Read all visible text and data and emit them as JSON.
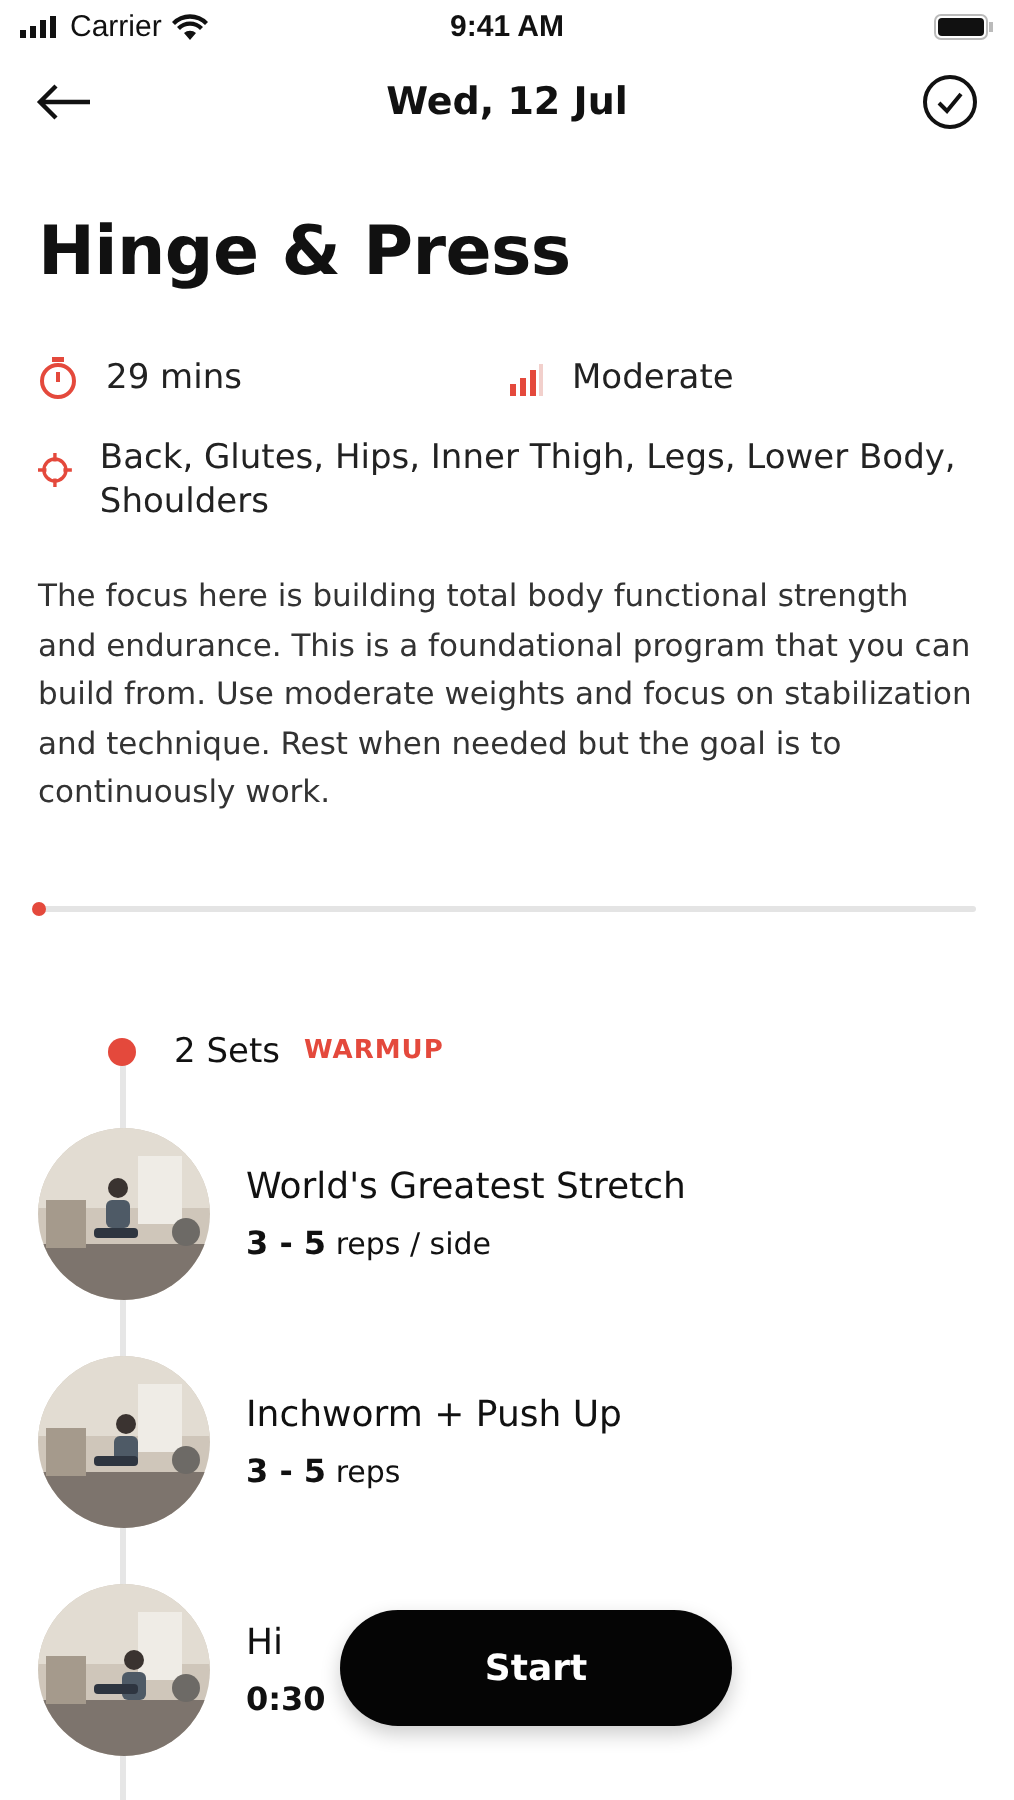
{
  "status_bar": {
    "carrier": "Carrier",
    "time": "9:41 AM"
  },
  "nav": {
    "title": "Wed, 12 Jul"
  },
  "workout": {
    "title": "Hinge & Press",
    "duration": "29 mins",
    "difficulty": "Moderate",
    "focus_areas": "Back, Glutes, Hips, Inner Thigh, Legs, Lower Body, Shoulders",
    "description": "The focus here is building total body functional strength and endurance. This is a foundational program that you can build from. Use moderate weights and focus on stabilization and technique. Rest when needed but the goal is to continuously work."
  },
  "progress": {
    "level": 0
  },
  "section": {
    "sets": "2 Sets",
    "tag": "WARMUP"
  },
  "exercises": [
    {
      "kind": "picture",
      "name": "World's Greatest Stretch",
      "detail": "**3 - 5** reps / side"
    },
    {
      "kind": "picture",
      "name": "Inchworm + Push Up",
      "detail": "**3 - 5** reps"
    },
    {
      "kind": "picture",
      "name": "Hi",
      "detail": "**0:30**"
    }
  ],
  "start_button": "Start"
}
